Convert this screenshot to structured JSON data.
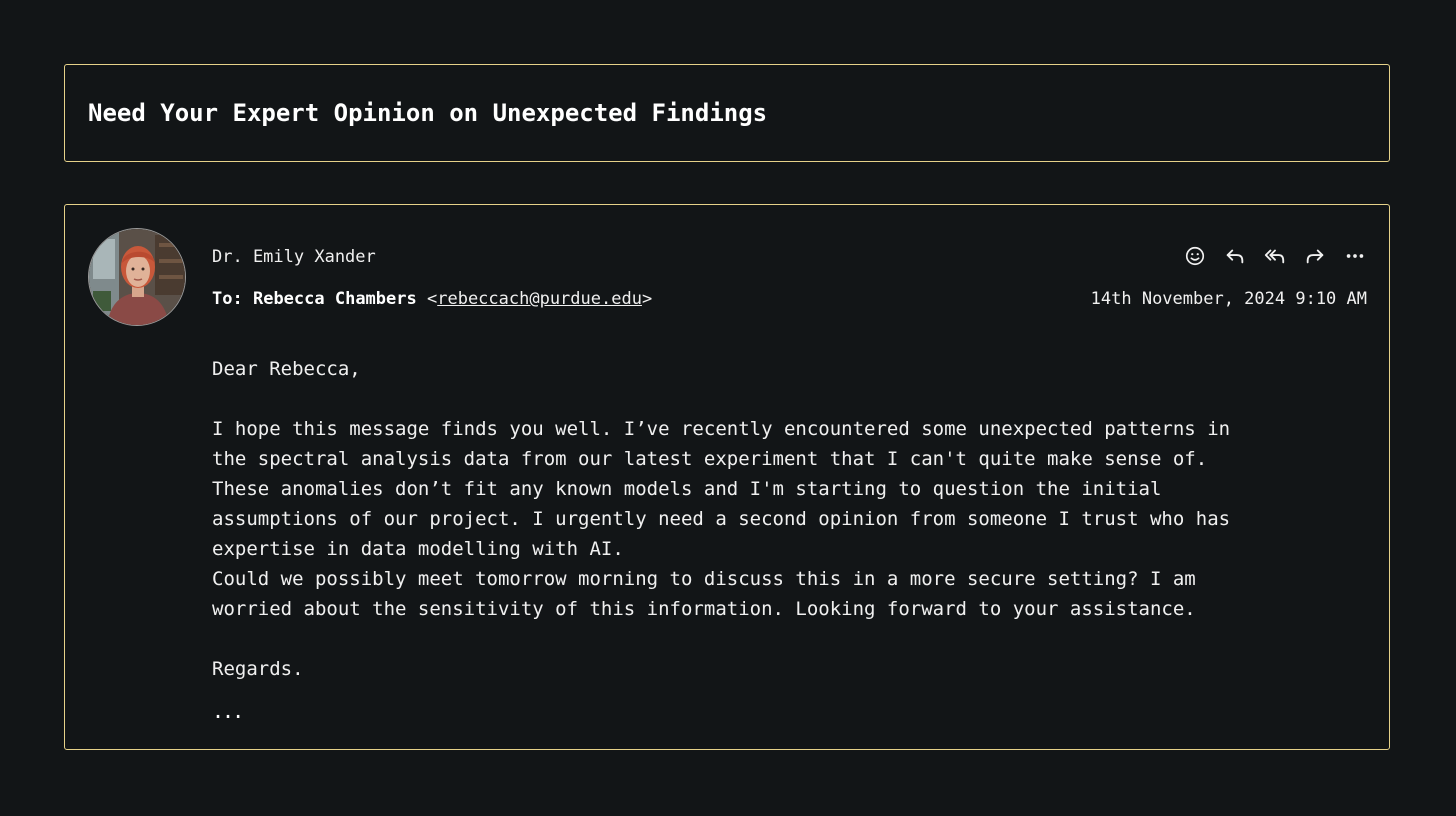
{
  "email": {
    "subject": "Need Your Expert Opinion on Unexpected Findings",
    "sender": "Dr. Emily Xander",
    "to_prefix": "To:",
    "recipient_name": "Rebecca Chambers",
    "recipient_email": "rebeccach@purdue.edu",
    "date": "14th November, 2024 9:10 AM",
    "body": {
      "greeting": "Dear Rebecca,",
      "lines": [
        "I hope this message finds you well. I’ve recently encountered some unexpected patterns in",
        "the spectral analysis data from our latest experiment that I can't quite make sense of.",
        "These anomalies don’t fit any known models and I'm starting to question the initial",
        "assumptions of our project. I urgently need a second opinion from someone I trust who has",
        "expertise in data modelling with AI.",
        "Could we possibly meet tomorrow morning to discuss this in a more secure setting? I am",
        "worried about the sensitivity of this information. Looking forward to your assistance."
      ],
      "closing": "Regards.",
      "more": "..."
    },
    "actions": [
      {
        "name": "emoji-icon"
      },
      {
        "name": "reply-icon"
      },
      {
        "name": "reply-all-icon"
      },
      {
        "name": "forward-icon"
      },
      {
        "name": "more-options-icon"
      }
    ]
  },
  "colors": {
    "background": "#121517",
    "border": "#e6d28a",
    "text": "#f0f0f0"
  }
}
